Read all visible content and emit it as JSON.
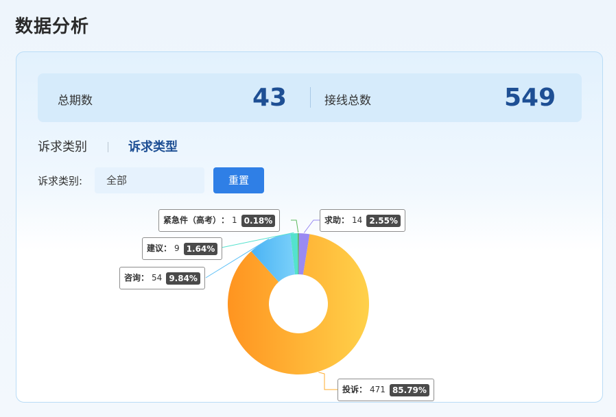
{
  "page": {
    "title": "数据分析"
  },
  "stats": {
    "periods_label": "总期数",
    "periods_value": "43",
    "calls_label": "接线总数",
    "calls_value": "549"
  },
  "tabs": [
    {
      "label": "诉求类别",
      "active": false
    },
    {
      "label": "诉求类型",
      "active": true
    }
  ],
  "filter": {
    "label": "诉求类别:",
    "selected": "全部",
    "reset_label": "重置"
  },
  "colors": {
    "accent": "#2f7fe6",
    "stat_value": "#1e4f94"
  },
  "chart_data": {
    "type": "pie",
    "categories": [
      "投诉",
      "咨询",
      "建议",
      "紧急件（高考）",
      "求助"
    ],
    "values": [
      471,
      54,
      9,
      1,
      14
    ],
    "percent_labels": [
      "85.79%",
      "9.84%",
      "1.64%",
      "0.18%",
      "2.55%"
    ],
    "colors": [
      "#ffab2e",
      "#5bbff6",
      "#54e2ce",
      "#5cb85c",
      "#9a8af2"
    ]
  }
}
